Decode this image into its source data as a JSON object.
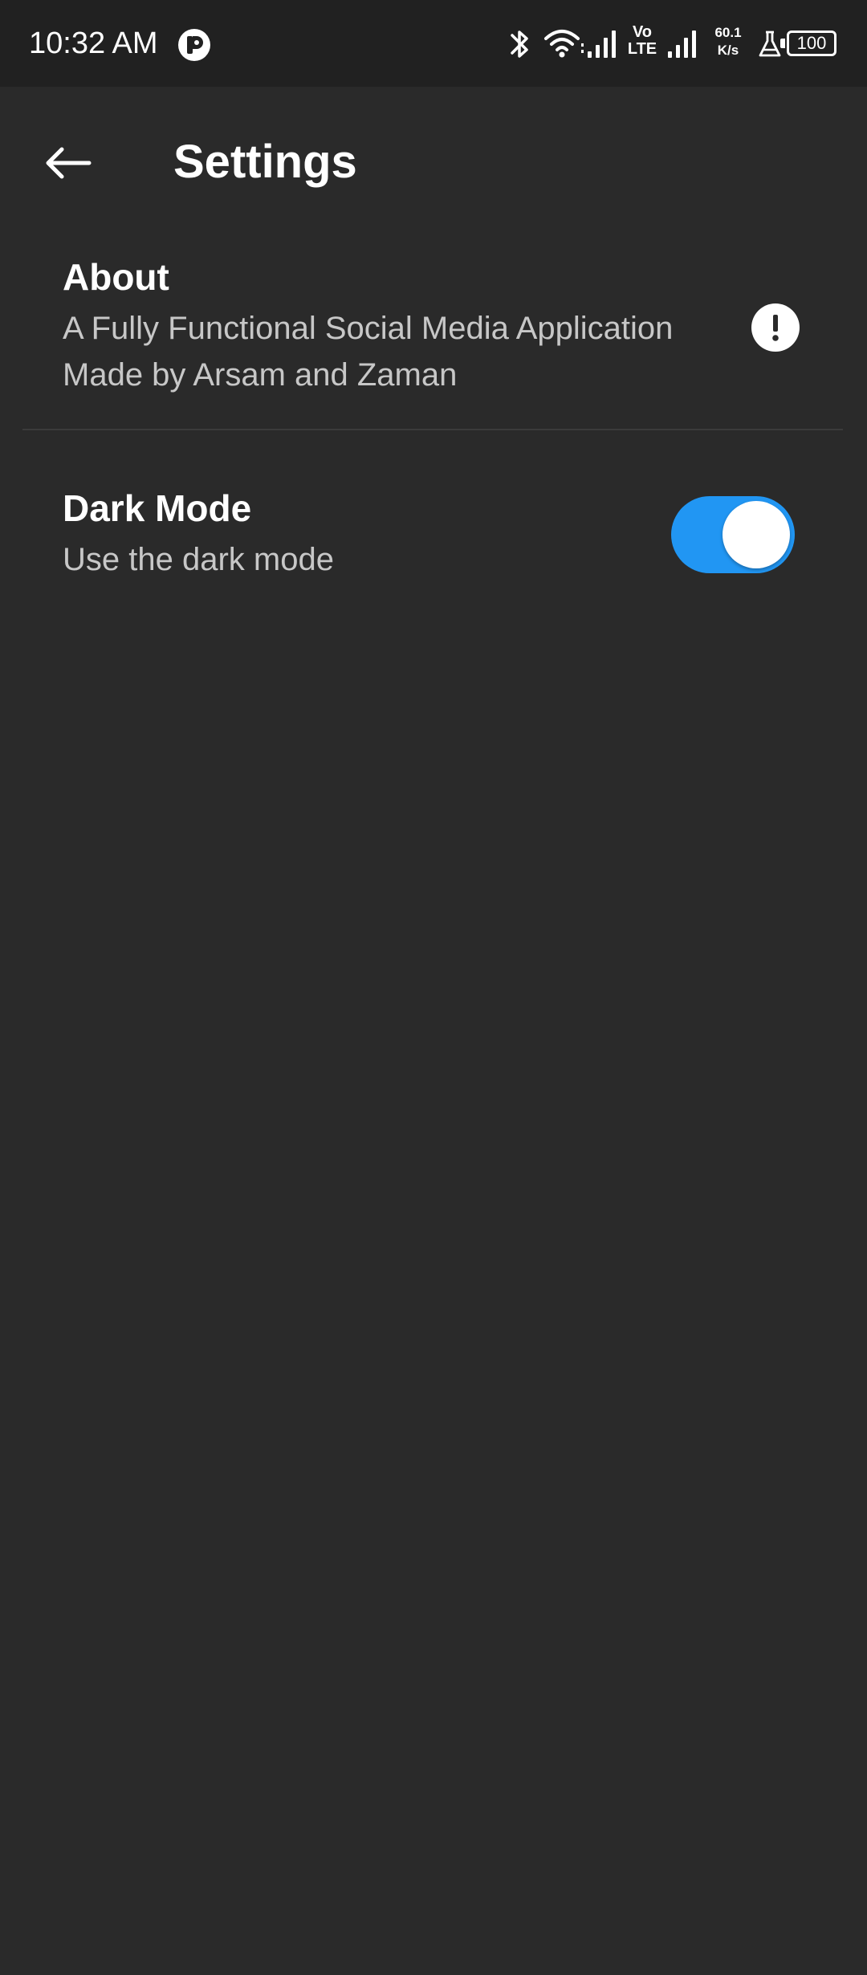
{
  "status_bar": {
    "time": "10:32 AM",
    "volte_line1": "Vo",
    "volte_line2": "LTE",
    "speed_value": "60.1",
    "speed_unit": "K/s",
    "battery": "100",
    "icons": [
      "app-notification-icon",
      "bluetooth-icon",
      "wifi-icon",
      "signal-icon",
      "signal-icon",
      "flask-icon",
      "battery-icon"
    ]
  },
  "app_bar": {
    "title": "Settings",
    "back_icon": "arrow-left-icon"
  },
  "settings": {
    "about": {
      "title": "About",
      "subtitle": "A Fully Functional Social Media Application Made by Arsam and Zaman",
      "icon": "info-exclamation-icon"
    },
    "dark_mode": {
      "title": "Dark Mode",
      "subtitle": "Use the dark mode",
      "enabled": true
    }
  },
  "colors": {
    "background": "#2a2a2a",
    "status_bar": "#212121",
    "accent": "#2196f3",
    "subtitle_text": "#c7c7c7"
  }
}
